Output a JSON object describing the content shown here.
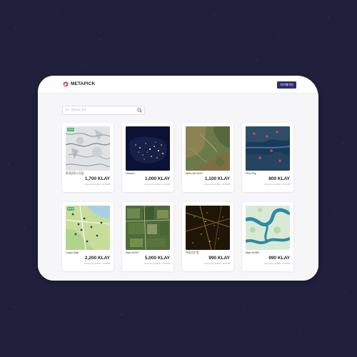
{
  "app": {
    "brand": "METAPICK",
    "top_button_label": "마이페이지"
  },
  "search": {
    "placeholder": "주소, 컨텐츠로 검색"
  },
  "cards": [
    {
      "title": "한강공원 나무숲",
      "price": "1,700 KLAY",
      "owner": "Owned by 0x8Ab...2F322B",
      "badge": "SALE",
      "thumb": "snow-terrain"
    },
    {
      "title": "Vision9",
      "price": "1,000 KLAY",
      "owner": "Owned by 0x8Ab...2F322B",
      "badge": "",
      "thumb": "night-lights"
    },
    {
      "title": "Meta Bd #100",
      "price": "1,100 KLAY",
      "owner": "Owned by 0x8Ab...2F322B",
      "badge": "",
      "thumb": "satellite-terrain"
    },
    {
      "title": "Pink Pop",
      "price": "800 KLAY",
      "owner": "Owned by 0x8Ab...2F322B",
      "badge": "",
      "thumb": "dark-pin-map"
    },
    {
      "title": "Crazy Map",
      "price": "2,200 KLAY",
      "owner": "Owned by 0x8Ab...2F322B",
      "badge": "SALE",
      "thumb": "pin-map"
    },
    {
      "title": "Map #0007",
      "price": "5,000 KLAY",
      "owner": "Owned by 0x8Ab...2F322B",
      "badge": "",
      "thumb": "green-fields"
    },
    {
      "title": "어둠다운 밤",
      "price": "990 KLAY",
      "owner": "Owned by 0x8Ab...2F322B",
      "badge": "",
      "thumb": "night-city"
    },
    {
      "title": "Map #0080",
      "price": "990 KLAY",
      "owner": "Owned by 0x8Ab...2F322B",
      "badge": "",
      "thumb": "river-map"
    }
  ],
  "colors": {
    "background": "#20203d",
    "accent": "#2b2f6e",
    "badge": "#4fb56b"
  }
}
